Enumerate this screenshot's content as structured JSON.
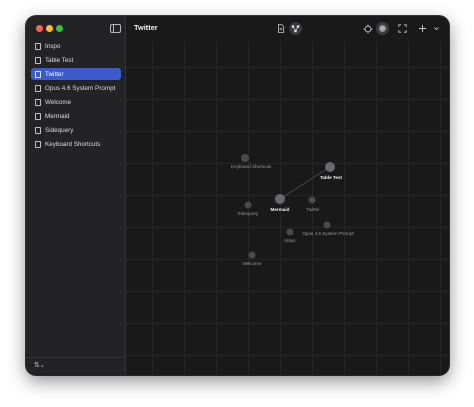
{
  "window": {
    "title": "Twitter"
  },
  "sidebar": {
    "items": [
      {
        "label": "Inspo",
        "active": false
      },
      {
        "label": "Table Test",
        "active": false
      },
      {
        "label": "Twitter",
        "active": true
      },
      {
        "label": "Opus 4.6 System Prompt",
        "active": false
      },
      {
        "label": "Welcome",
        "active": false
      },
      {
        "label": "Mermaid",
        "active": false
      },
      {
        "label": "Sidequery",
        "active": false
      },
      {
        "label": "Keyboard Shortcuts",
        "active": false
      }
    ],
    "sort_icon": "sort-arrows-icon"
  },
  "toolbar": {
    "icons": [
      "document-icon",
      "graph-view-icon",
      "crosshair-icon",
      "globe-icon",
      "fullscreen-icon",
      "plus-icon",
      "chevron-down-icon"
    ],
    "graph_view_active": true
  },
  "graph": {
    "nodes": [
      {
        "id": "keyboard-shortcuts",
        "label": "Keyboard Shortcuts",
        "emphasis": false
      },
      {
        "id": "table-test",
        "label": "Table Test",
        "emphasis": true
      },
      {
        "id": "mermaid",
        "label": "Mermaid",
        "emphasis": true
      },
      {
        "id": "twitter",
        "label": "Twitter",
        "emphasis": false
      },
      {
        "id": "sidequery",
        "label": "Sidequery",
        "emphasis": false
      },
      {
        "id": "opus",
        "label": "Opus 4.6 System Prompt",
        "emphasis": false
      },
      {
        "id": "inspo",
        "label": "Inspo",
        "emphasis": false
      },
      {
        "id": "welcome",
        "label": "Welcome",
        "emphasis": false
      }
    ],
    "edges": [
      {
        "from": "mermaid",
        "to": "table-test"
      }
    ]
  },
  "colors": {
    "accent": "#3b5bcf",
    "traffic_close": "#ff5f57",
    "traffic_min": "#febc2e",
    "traffic_max": "#28c840"
  }
}
